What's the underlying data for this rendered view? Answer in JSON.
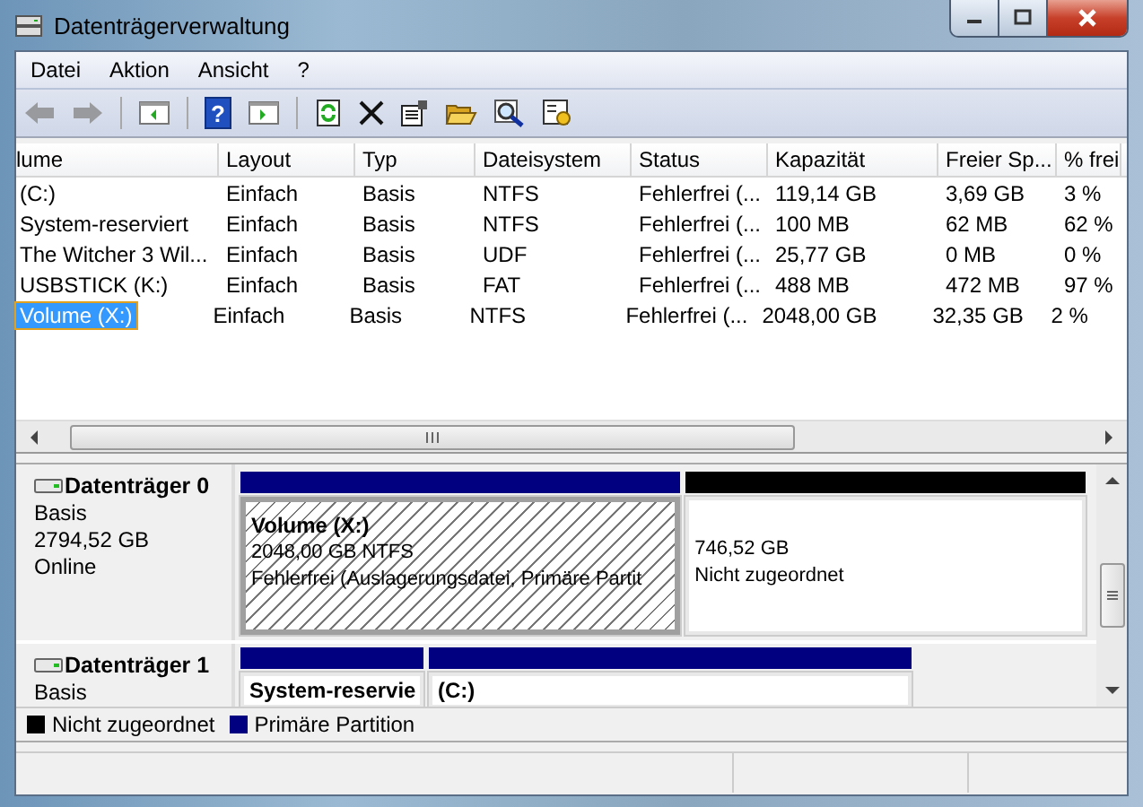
{
  "window": {
    "title": "Datenträgerverwaltung"
  },
  "menu": [
    "Datei",
    "Aktion",
    "Ansicht",
    "?"
  ],
  "toolbar": [
    {
      "kind": "back",
      "disabled": true
    },
    {
      "kind": "forward",
      "disabled": true
    },
    {
      "kind": "sep"
    },
    {
      "kind": "panel-left"
    },
    {
      "kind": "sep"
    },
    {
      "kind": "help",
      "glyph": "?"
    },
    {
      "kind": "panel-right"
    },
    {
      "kind": "sep"
    },
    {
      "kind": "refresh"
    },
    {
      "kind": "delete"
    },
    {
      "kind": "properties"
    },
    {
      "kind": "folder"
    },
    {
      "kind": "search"
    },
    {
      "kind": "settings"
    }
  ],
  "table": {
    "columns": [
      "lume",
      "Layout",
      "Typ",
      "Dateisystem",
      "Status",
      "Kapazität",
      "Freier Sp...",
      "% frei"
    ],
    "rows": [
      {
        "cells": [
          " (C:)",
          "Einfach",
          "Basis",
          "NTFS",
          "Fehlerfrei (...",
          "119,14 GB",
          "3,69 GB",
          "3 %"
        ],
        "selected": false
      },
      {
        "cells": [
          "System-reserviert",
          "Einfach",
          "Basis",
          "NTFS",
          "Fehlerfrei (...",
          "100 MB",
          "62 MB",
          "62 %"
        ],
        "selected": false
      },
      {
        "cells": [
          "The Witcher 3 Wil...",
          "Einfach",
          "Basis",
          "UDF",
          "Fehlerfrei (...",
          "25,77 GB",
          "0 MB",
          "0 %"
        ],
        "selected": false
      },
      {
        "cells": [
          "USBSTICK (K:)",
          "Einfach",
          "Basis",
          "FAT",
          "Fehlerfrei (...",
          "488 MB",
          "472 MB",
          "97 %"
        ],
        "selected": false
      },
      {
        "cells": [
          "Volume (X:)",
          "Einfach",
          "Basis",
          "NTFS",
          "Fehlerfrei (...",
          "2048,00 GB",
          "32,35 GB",
          "2 %"
        ],
        "selected": true
      }
    ]
  },
  "disks": [
    {
      "name": "Datenträger 0",
      "lines": [
        "Basis",
        "2794,52 GB",
        "Online"
      ],
      "partitions": [
        {
          "kind": "primary",
          "selected": true,
          "title": "Volume  (X:)",
          "lines": [
            "2048,00 GB NTFS",
            "Fehlerfrei (Auslagerungsdatei, Primäre Partit"
          ]
        },
        {
          "kind": "unallocated",
          "selected": false,
          "lines": [
            "746,52 GB",
            "Nicht zugeordnet"
          ]
        }
      ]
    },
    {
      "name": "Datenträger 1",
      "lines": [
        "Basis"
      ],
      "partitions": [
        {
          "kind": "primary",
          "selected": false,
          "title": "System-reservie"
        },
        {
          "kind": "primary",
          "selected": false,
          "title": " (C:)"
        }
      ]
    }
  ],
  "legend": [
    {
      "label": "Nicht zugeordnet",
      "color": "#000000"
    },
    {
      "label": "Primäre Partition",
      "color": "#000080"
    }
  ]
}
